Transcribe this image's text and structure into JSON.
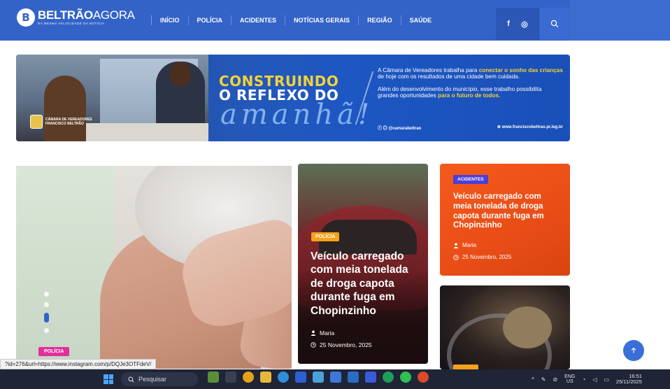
{
  "site": {
    "logo_title_bold": "BELTRÃO",
    "logo_title_light": "AGORA",
    "logo_tagline": "NA MESMA VELOCIDADE DA NOTÍCIA"
  },
  "nav": {
    "items": [
      {
        "label": "INÍCIO"
      },
      {
        "label": "POLÍCIA"
      },
      {
        "label": "ACIDENTES"
      },
      {
        "label": "NOTÍCIAS GERAIS"
      },
      {
        "label": "REGIÃO"
      },
      {
        "label": "SAÚDE"
      }
    ],
    "social": [
      "f",
      "◎"
    ]
  },
  "banner": {
    "headline_1": "CONSTRUINDO",
    "headline_2": "O REFLEXO DO",
    "script": "amanhã!",
    "camara_line1": "CÂMARA DE VEREADORES",
    "camara_line2": "FRANCISCO BELTRÃO",
    "para1_a": "A Câmara de Vereadores  trabalha para ",
    "para1_hl": "conectar o sonho das crianças",
    "para1_b": " de hoje com os resultados de uma cidade bem cuidada.",
    "para2_a": "Além do desenvolvimento do município, esse trabalho possibilita grandes oportunidades ",
    "para2_hl": "para o futuro de todos.",
    "foot_social": "ⓕ ◎ @camarabeltrao",
    "foot_site": "⊕ www.franciscobeltrao.pr.leg.br"
  },
  "featured": {
    "large_tag": "POLÍCIA",
    "mid_tag": "POLÍCIA",
    "mid_title": "Veículo carregado com meia tonelada de droga capota durante fuga em Chopinzinho",
    "mid_author": "Maria",
    "mid_date": "25 Novembro, 2025",
    "right_tag": "ACIDENTES",
    "right_title": "Veículo carregado com meia tonelada de droga capota durante fuga em Chopinzinho",
    "right_author": "Maria",
    "right_date": "25 Novembro, 2025"
  },
  "status_url": "?id=276&url=https://www.instagram.com/p/DQJe3OTFdeV/",
  "taskbar": {
    "search_placeholder": "Pesquisar",
    "lang_1": "ENG",
    "lang_2": "US",
    "time": "16:51",
    "date": "25/11/2025"
  },
  "colors": {
    "nav_blue": "#3463c8",
    "policia_pink": "#e0309a",
    "policia_orange": "#f3a21a",
    "acidentes_purple": "#4c3ed8",
    "card_orange": "#f45a1c"
  }
}
